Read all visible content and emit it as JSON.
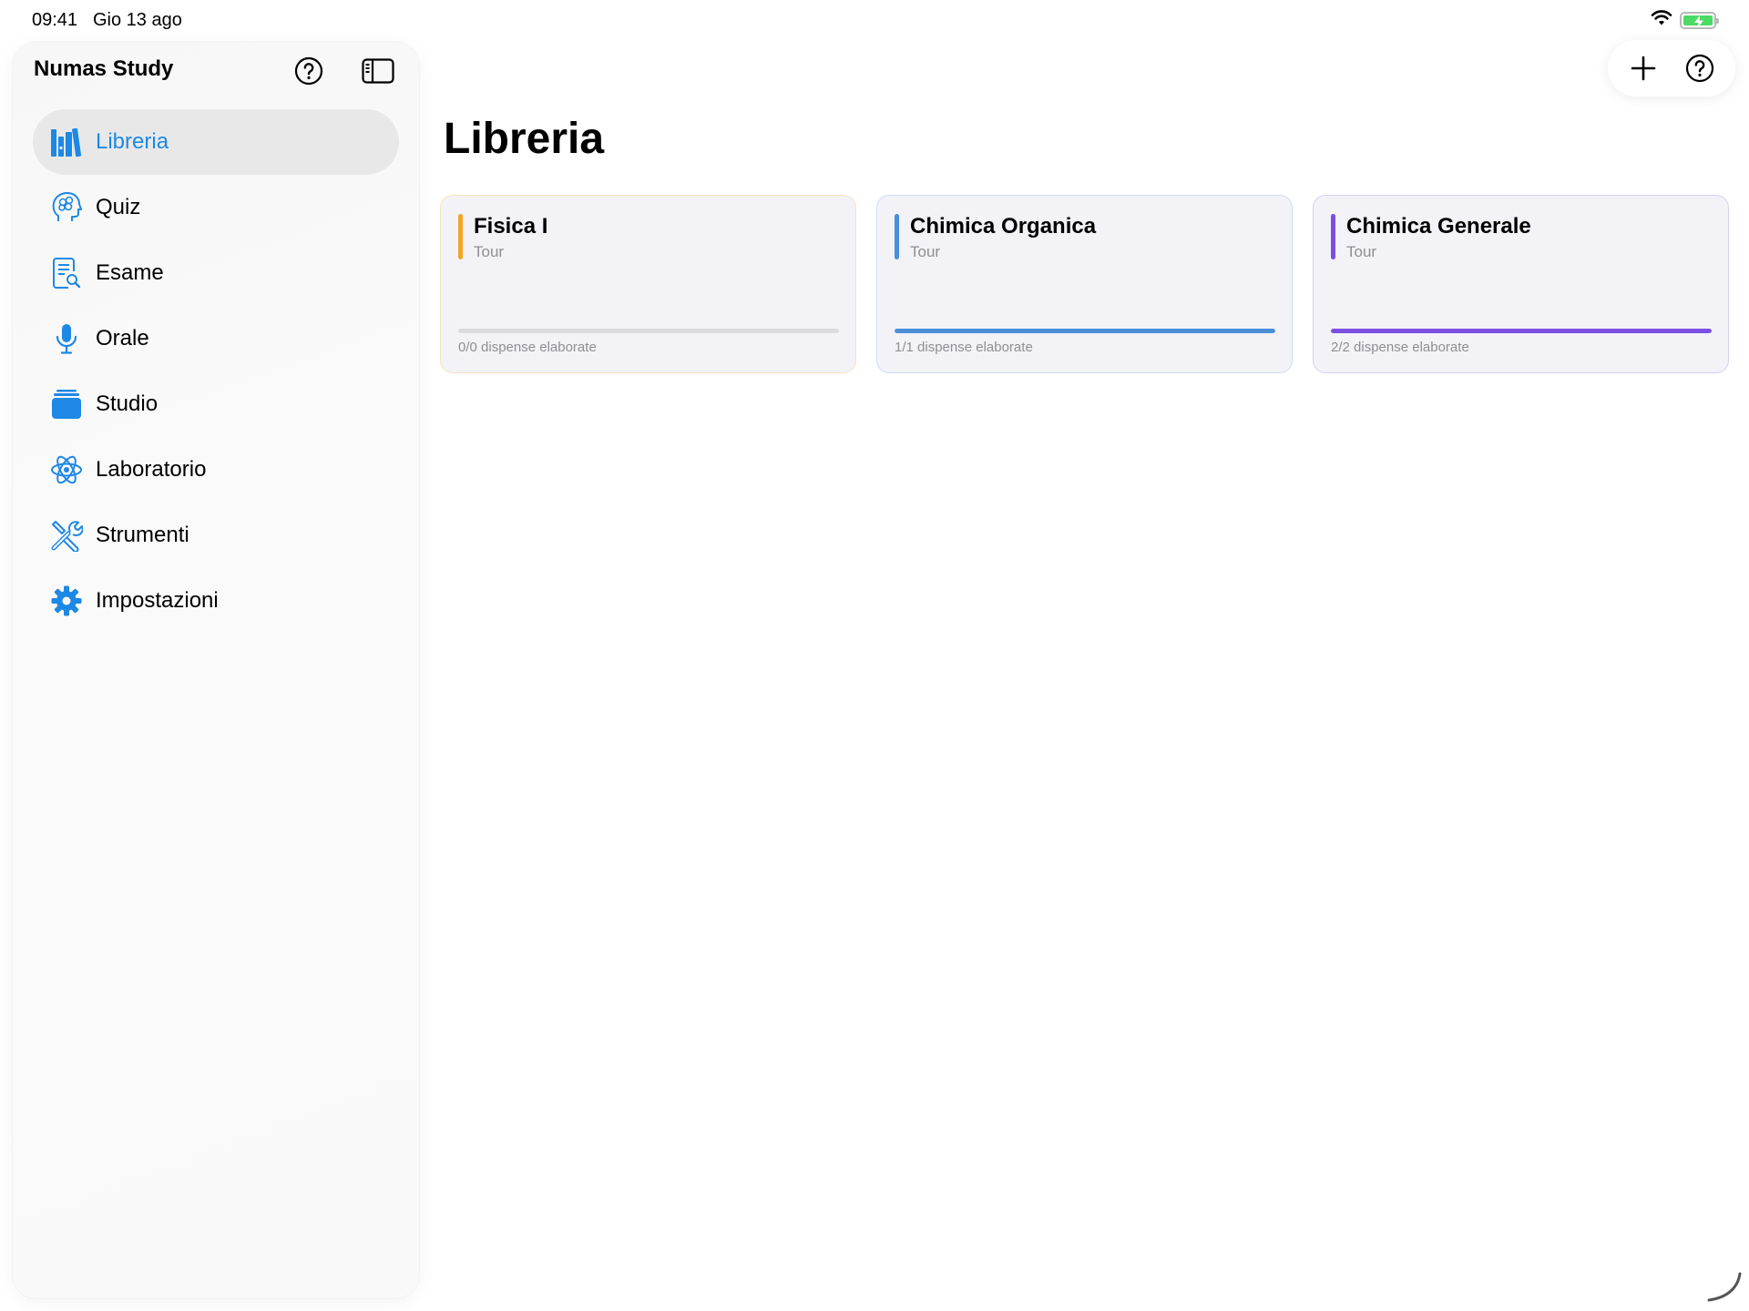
{
  "status_bar": {
    "time": "09:41",
    "date": "Gio 13 ago",
    "battery_level": 1.0,
    "icons": [
      "wifi-icon",
      "battery-charging-icon"
    ]
  },
  "sidebar": {
    "title": "Numas Study",
    "help_icon": "question-circle-icon",
    "toggle_icon": "sidebar-toggle-icon",
    "items": [
      {
        "label": "Libreria",
        "icon": "books-icon",
        "active": true
      },
      {
        "label": "Quiz",
        "icon": "brain-head-icon",
        "active": false
      },
      {
        "label": "Esame",
        "icon": "document-search-icon",
        "active": false
      },
      {
        "label": "Orale",
        "icon": "microphone-icon",
        "active": false
      },
      {
        "label": "Studio",
        "icon": "stack-icon",
        "active": false
      },
      {
        "label": "Laboratorio",
        "icon": "atom-icon",
        "active": false
      },
      {
        "label": "Strumenti",
        "icon": "tools-icon",
        "active": false
      },
      {
        "label": "Impostazioni",
        "icon": "gear-icon",
        "active": false
      }
    ]
  },
  "toolbar": {
    "add_icon": "plus-icon",
    "help_icon": "question-circle-icon"
  },
  "main": {
    "title": "Libreria",
    "cards": [
      {
        "title": "Fisica I",
        "subtitle": "Tour",
        "progress_label": "0/0 dispense elaborate",
        "progress": 0,
        "accent_color": "#f5a524",
        "border_color": "#f6e3bf"
      },
      {
        "title": "Chimica Organica",
        "subtitle": "Tour",
        "progress_label": "1/1 dispense elaborate",
        "progress": 1,
        "accent_color": "#4a8fd8",
        "border_color": "#cfdcf0"
      },
      {
        "title": "Chimica Generale",
        "subtitle": "Tour",
        "progress_label": "2/2 dispense elaborate",
        "progress": 1,
        "accent_color": "#7b4fe0",
        "border_color": "#d8cff0"
      }
    ]
  },
  "colors": {
    "accent_blue": "#1e88e5",
    "active_bg": "#e8e8e8",
    "card_bg": "#f2f2f7",
    "secondary_text": "#8e8e93"
  }
}
